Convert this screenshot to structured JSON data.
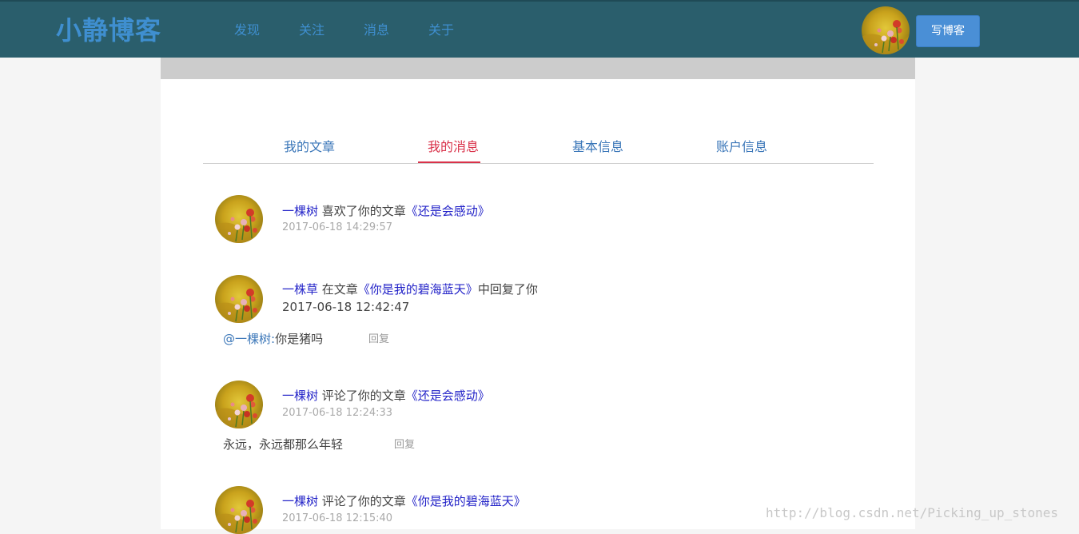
{
  "header": {
    "brand": "小静博客",
    "nav": [
      "发现",
      "关注",
      "消息",
      "关于"
    ],
    "write_button": "写博客"
  },
  "tabs": [
    "我的文章",
    "我的消息",
    "基本信息",
    "账户信息"
  ],
  "active_tab": "我的消息",
  "messages": [
    {
      "user": "一棵树",
      "action": " 喜欢了你的文章",
      "article": "《还是会感动》",
      "suffix": "",
      "time": "2017-06-18 14:29:57"
    },
    {
      "user": "一株草",
      "action": " 在文章",
      "article": "《你是我的碧海蓝天》",
      "suffix": "中回复了你",
      "time": "2017-06-18 12:42:47",
      "reply_mention": "@一棵树:",
      "reply_text": "你是猪吗",
      "reply_label": "回复"
    },
    {
      "user": "一棵树",
      "action": " 评论了你的文章",
      "article": "《还是会感动》",
      "suffix": "",
      "time": "2017-06-18 12:24:33",
      "comment": "永远，永远都那么年轻",
      "reply_label": "回复"
    },
    {
      "user": "一棵树",
      "action": " 评论了你的文章",
      "article": "《你是我的碧海蓝天》",
      "suffix": "",
      "time": "2017-06-18 12:15:40"
    }
  ],
  "watermark": "http://blog.csdn.net/Picking_up_stones",
  "colors": {
    "header_bg": "#2a5e6c",
    "brand": "#3f8fd0",
    "active_tab": "#d9324a",
    "link": "#2323c8",
    "button": "#4a8fd6"
  }
}
